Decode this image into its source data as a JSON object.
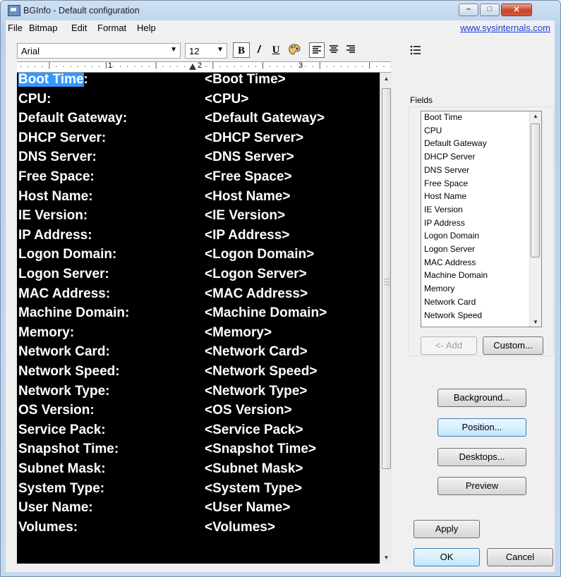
{
  "window": {
    "title": "BGInfo - Default configuration"
  },
  "menu": {
    "file": "File",
    "bitmap": "Bitmap",
    "edit": "Edit",
    "format": "Format",
    "help": "Help",
    "url": "www.sysinternals.com"
  },
  "toolbar": {
    "font": "Arial",
    "size": "12",
    "bold_icon": "B",
    "italic_icon": "/",
    "underline_icon": "U",
    "color_icon": "paint-palette",
    "align_left_icon": "align-left",
    "align_center_icon": "align-center",
    "align_right_icon": "align-right",
    "bullets_icon": "bulleted-list"
  },
  "ruler": {
    "n1": "1",
    "n2": "2",
    "n3": "3"
  },
  "editor": {
    "rows": [
      {
        "label": "Boot Time",
        "suffix": ":",
        "value": "<Boot Time>"
      },
      {
        "label": "CPU:",
        "value": "<CPU>"
      },
      {
        "label": "Default Gateway:",
        "value": "<Default Gateway>"
      },
      {
        "label": "DHCP Server:",
        "value": "<DHCP Server>"
      },
      {
        "label": "DNS Server:",
        "value": "<DNS Server>"
      },
      {
        "label": "Free Space:",
        "value": "<Free Space>"
      },
      {
        "label": "Host Name:",
        "value": "<Host Name>"
      },
      {
        "label": "IE Version:",
        "value": "<IE Version>"
      },
      {
        "label": "IP Address:",
        "value": "<IP Address>"
      },
      {
        "label": "Logon Domain:",
        "value": "<Logon Domain>"
      },
      {
        "label": "Logon Server:",
        "value": "<Logon Server>"
      },
      {
        "label": "MAC Address:",
        "value": "<MAC Address>"
      },
      {
        "label": "Machine Domain:",
        "value": "<Machine Domain>"
      },
      {
        "label": "Memory:",
        "value": "<Memory>"
      },
      {
        "label": "Network Card:",
        "value": "<Network Card>"
      },
      {
        "label": "Network Speed:",
        "value": "<Network Speed>"
      },
      {
        "label": "Network Type:",
        "value": "<Network Type>"
      },
      {
        "label": "OS Version:",
        "value": "<OS Version>"
      },
      {
        "label": "Service Pack:",
        "value": "<Service Pack>"
      },
      {
        "label": "Snapshot Time:",
        "value": "<Snapshot Time>"
      },
      {
        "label": "Subnet Mask:",
        "value": "<Subnet Mask>"
      },
      {
        "label": "System Type:",
        "value": "<System Type>"
      },
      {
        "label": "User Name:",
        "value": "<User Name>"
      },
      {
        "label": "Volumes:",
        "value": "<Volumes>"
      }
    ]
  },
  "fields": {
    "label": "Fields",
    "items": [
      "Boot Time",
      "CPU",
      "Default Gateway",
      "DHCP Server",
      "DNS Server",
      "Free Space",
      "Host Name",
      "IE Version",
      "IP Address",
      "Logon Domain",
      "Logon Server",
      "MAC Address",
      "Machine Domain",
      "Memory",
      "Network Card",
      "Network Speed"
    ],
    "add": "<- Add",
    "custom": "Custom..."
  },
  "buttons": {
    "background": "Background...",
    "position": "Position...",
    "desktops": "Desktops...",
    "preview": "Preview",
    "apply": "Apply",
    "ok": "OK",
    "cancel": "Cancel"
  },
  "colors": {
    "editor_bg": "#000000",
    "editor_text": "#ffffff",
    "selection": "#3399ff",
    "link": "#1a3bd6"
  }
}
